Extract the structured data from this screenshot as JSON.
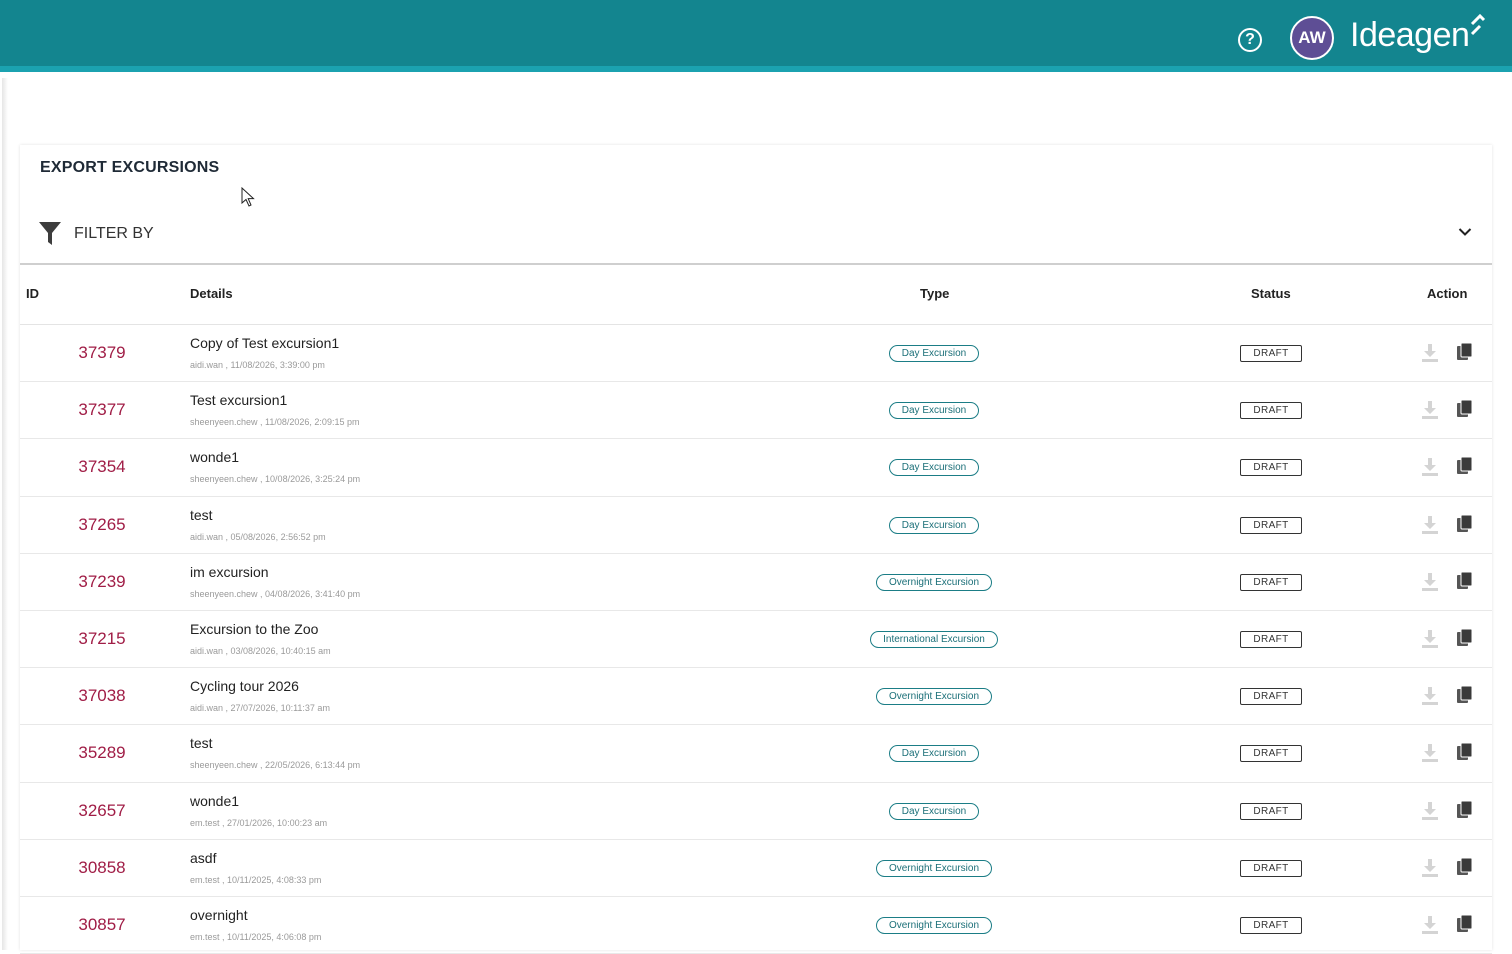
{
  "header": {
    "help_icon": "help-circle-icon",
    "avatar_initials": "AW",
    "brand": "Ideagen"
  },
  "page": {
    "title": "EXPORT EXCURSIONS",
    "filter_label": "FILTER BY"
  },
  "table": {
    "columns": {
      "id": "ID",
      "details": "Details",
      "type": "Type",
      "status": "Status",
      "action": "Action"
    },
    "rows": [
      {
        "id": "37379",
        "title": "Copy of Test excursion1",
        "sub": "aidi.wan , 11/08/2026, 3:39:00 pm",
        "type": "Day Excursion",
        "status": "DRAFT"
      },
      {
        "id": "37377",
        "title": "Test excursion1",
        "sub": "sheenyeen.chew , 11/08/2026, 2:09:15 pm",
        "type": "Day Excursion",
        "status": "DRAFT"
      },
      {
        "id": "37354",
        "title": "wonde1",
        "sub": "sheenyeen.chew , 10/08/2026, 3:25:24 pm",
        "type": "Day Excursion",
        "status": "DRAFT"
      },
      {
        "id": "37265",
        "title": "test",
        "sub": "aidi.wan , 05/08/2026, 2:56:52 pm",
        "type": "Day Excursion",
        "status": "DRAFT"
      },
      {
        "id": "37239",
        "title": "im excursion",
        "sub": "sheenyeen.chew , 04/08/2026, 3:41:40 pm",
        "type": "Overnight Excursion",
        "status": "DRAFT"
      },
      {
        "id": "37215",
        "title": "Excursion to the Zoo",
        "sub": "aidi.wan , 03/08/2026, 10:40:15 am",
        "type": "International Excursion",
        "status": "DRAFT"
      },
      {
        "id": "37038",
        "title": "Cycling tour 2026",
        "sub": "aidi.wan , 27/07/2026, 10:11:37 am",
        "type": "Overnight Excursion",
        "status": "DRAFT"
      },
      {
        "id": "35289",
        "title": "test",
        "sub": "sheenyeen.chew , 22/05/2026, 6:13:44 pm",
        "type": "Day Excursion",
        "status": "DRAFT"
      },
      {
        "id": "32657",
        "title": "wonde1",
        "sub": "em.test , 27/01/2026, 10:00:23 am",
        "type": "Day Excursion",
        "status": "DRAFT"
      },
      {
        "id": "30858",
        "title": "asdf",
        "sub": "em.test , 10/11/2025, 4:08:33 pm",
        "type": "Overnight Excursion",
        "status": "DRAFT"
      },
      {
        "id": "30857",
        "title": "overnight",
        "sub": "em.test , 10/11/2025, 4:06:08 pm",
        "type": "Overnight Excursion",
        "status": "DRAFT"
      }
    ]
  },
  "colors": {
    "header_bg": "#13858f",
    "header_accent": "#1ba2b0",
    "avatar_bg": "#5e4e95",
    "id_text": "#a01d46",
    "type_badge": "#1b7d86"
  },
  "icons": {
    "filter": "filter-funnel-icon",
    "chevron": "chevron-down-icon",
    "download": "download-icon",
    "copy": "copy-icon"
  }
}
